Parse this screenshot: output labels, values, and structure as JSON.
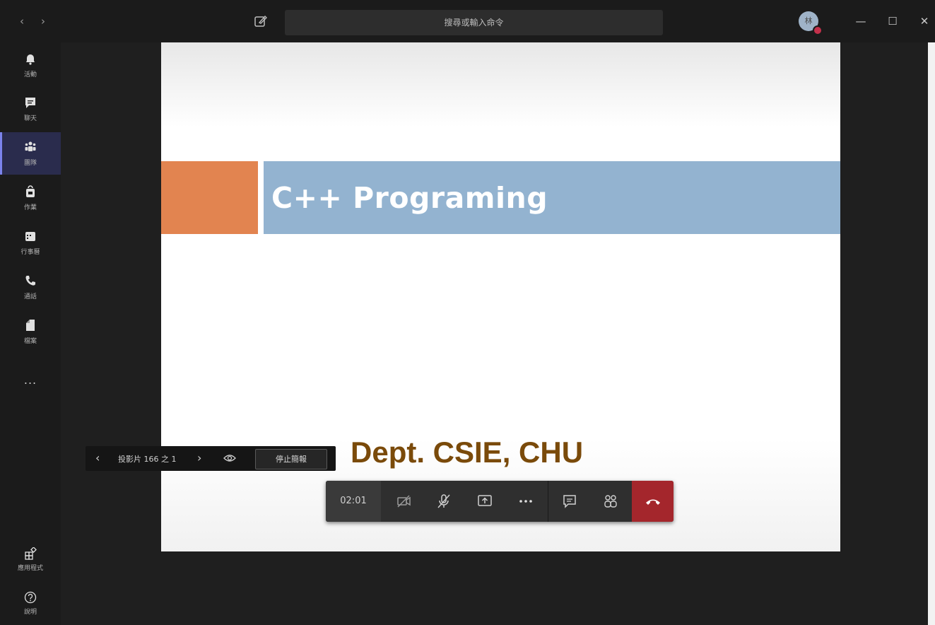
{
  "titlebar": {
    "search_placeholder": "搜尋或輸入命令",
    "avatar_initial": "林"
  },
  "rail": {
    "items": [
      {
        "label": "活動",
        "icon": "bell-icon"
      },
      {
        "label": "聊天",
        "icon": "chat-icon"
      },
      {
        "label": "團隊",
        "icon": "teams-icon",
        "active": true
      },
      {
        "label": "作業",
        "icon": "assignments-icon"
      },
      {
        "label": "行事曆",
        "icon": "calendar-icon"
      },
      {
        "label": "通話",
        "icon": "phone-icon"
      },
      {
        "label": "檔案",
        "icon": "file-icon"
      }
    ],
    "more": "...",
    "bottom": [
      {
        "label": "應用程式",
        "icon": "apps-icon"
      },
      {
        "label": "說明",
        "icon": "help-icon"
      }
    ]
  },
  "slide": {
    "title": "C++ Programing",
    "subtitle": "Dept. CSIE, CHU",
    "colors": {
      "orange": "#e28450",
      "blue": "#93b3d0",
      "subtitle": "#7a4a0a"
    }
  },
  "slide_controls": {
    "position_label": "投影片 166 之 1",
    "stop_button": "停止簡報"
  },
  "meeting_toolbar": {
    "timer": "02:01",
    "hangup_color": "#a4262c"
  }
}
